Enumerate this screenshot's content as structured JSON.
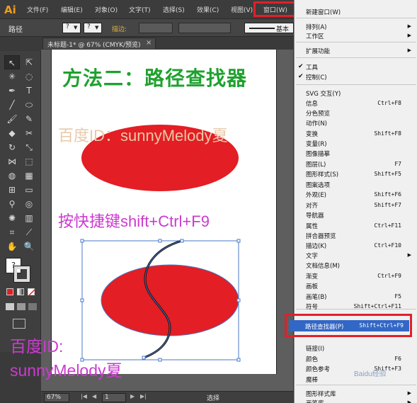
{
  "app": {
    "logo": "Ai"
  },
  "menubar": {
    "items": [
      "文件(F)",
      "编辑(E)",
      "对象(O)",
      "文字(T)",
      "选择(S)",
      "效果(C)",
      "视图(V)",
      "窗口(W)"
    ]
  },
  "controlbar": {
    "object_type": "路径",
    "stroke_label": "描边:",
    "brush_label": "基本"
  },
  "document": {
    "tab_title": "未标题-1* @ 67% (CMYK/预览)",
    "close": "×"
  },
  "artboard": {
    "title": "方法二：路径查找器",
    "watermark_top": "百度ID：sunnyMelody夏",
    "shortcut": "按快捷键shift+Ctrl+F9",
    "watermark_bottom_1": "百度ID:",
    "watermark_bottom_2": "sunnyMelody夏"
  },
  "colors": {
    "ellipse_fill": "#e31e24",
    "title_green": "#1fa12f",
    "magenta": "#cc3ad0",
    "selection_blue": "#4a78c8",
    "highlight_red": "#e0202a"
  },
  "statusbar": {
    "zoom": "67%",
    "page": "1",
    "status": "选择"
  },
  "window_menu": {
    "items": [
      {
        "label": "新建窗口(W)",
        "shortcut": ""
      },
      {
        "label": "排列(A)",
        "submenu": true
      },
      {
        "label": "工作区",
        "submenu": true
      },
      {
        "label": "扩展功能",
        "submenu": true
      },
      {
        "label": "工具",
        "checked": true
      },
      {
        "label": "控制(C)",
        "checked": true
      },
      {
        "label": "SVG 交互(Y)",
        "shortcut": ""
      },
      {
        "label": "信息",
        "shortcut": "Ctrl+F8"
      },
      {
        "label": "分色预览",
        "shortcut": ""
      },
      {
        "label": "动作(N)",
        "shortcut": ""
      },
      {
        "label": "变换",
        "shortcut": "Shift+F8"
      },
      {
        "label": "变量(R)",
        "shortcut": ""
      },
      {
        "label": "图像描摹",
        "shortcut": ""
      },
      {
        "label": "图层(L)",
        "shortcut": "F7"
      },
      {
        "label": "图形样式(S)",
        "shortcut": "Shift+F5"
      },
      {
        "label": "图案选项",
        "shortcut": ""
      },
      {
        "label": "外观(E)",
        "shortcut": "Shift+F6"
      },
      {
        "label": "对齐",
        "shortcut": "Shift+F7"
      },
      {
        "label": "导航器",
        "shortcut": ""
      },
      {
        "label": "属性",
        "shortcut": "Ctrl+F11"
      },
      {
        "label": "拼合器预览",
        "shortcut": ""
      },
      {
        "label": "描边(K)",
        "shortcut": "Ctrl+F10"
      },
      {
        "label": "文字",
        "submenu": true
      },
      {
        "label": "文档信息(M)",
        "shortcut": ""
      },
      {
        "label": "渐变",
        "shortcut": "Ctrl+F9"
      },
      {
        "label": "画板",
        "shortcut": ""
      },
      {
        "label": "画笔(B)",
        "shortcut": "F5"
      },
      {
        "label": "符号",
        "shortcut": "Shift+Ctrl+F11"
      },
      {
        "label": "路径查找器(P)",
        "shortcut": "Shift+Ctrl+F9",
        "highlighted": true
      },
      {
        "label": "链接(I)",
        "shortcut": ""
      },
      {
        "label": "颜色",
        "shortcut": "F6"
      },
      {
        "label": "颜色参考",
        "shortcut": "Shift+F3"
      },
      {
        "label": "魔棒",
        "shortcut": ""
      },
      {
        "label": "图形样式库",
        "submenu": true
      },
      {
        "label": "画笔库",
        "submenu": true
      }
    ]
  },
  "watermark": "Baidu经验"
}
